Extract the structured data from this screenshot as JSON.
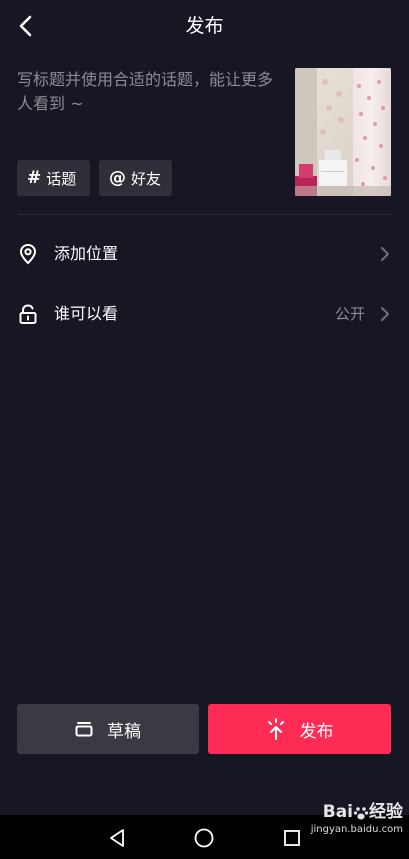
{
  "header": {
    "title": "发布"
  },
  "caption": {
    "placeholder": "写标题并使用合适的话题，能让更多人看到 ~"
  },
  "chips": {
    "topic": {
      "symbol": "#",
      "label": "话题"
    },
    "friend": {
      "symbol": "@",
      "label": "好友"
    }
  },
  "rows": {
    "location": {
      "label": "添加位置"
    },
    "visibility": {
      "label": "谁可以看",
      "value": "公开"
    }
  },
  "buttons": {
    "draft": "草稿",
    "publish": "发布"
  },
  "colors": {
    "background": "#161723",
    "accent": "#fe2c55",
    "chip": "#2e2f39",
    "draft_button": "#393a44",
    "muted_text": "#8a8b93"
  },
  "watermark": {
    "main_suffix": "经验",
    "sub": "jingyan.baidu.com"
  },
  "icons": [
    "back-arrow-icon",
    "hash-icon",
    "at-icon",
    "location-pin-icon",
    "unlock-icon",
    "chevron-right-icon",
    "draft-box-icon",
    "publish-spark-icon",
    "nav-back-icon",
    "nav-home-icon",
    "nav-recents-icon"
  ]
}
